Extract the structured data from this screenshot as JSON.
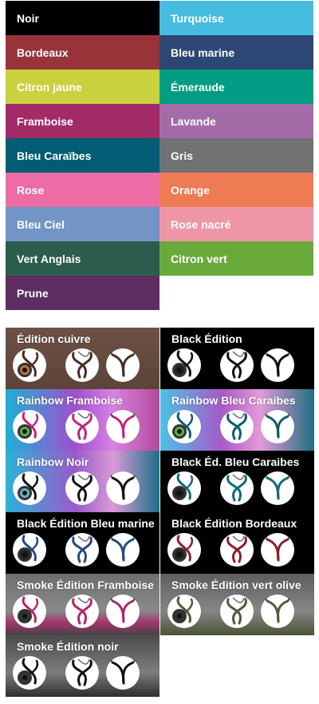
{
  "colors": [
    {
      "label": "Noir",
      "bg": "#000000"
    },
    {
      "label": "Turquoise",
      "bg": "#46bde0"
    },
    {
      "label": "Bordeaux",
      "bg": "#98333a"
    },
    {
      "label": "Bleu marine",
      "bg": "#2d4775"
    },
    {
      "label": "Citron jaune",
      "bg": "#c9d13e"
    },
    {
      "label": "Émeraude",
      "bg": "#009d84"
    },
    {
      "label": "Framboise",
      "bg": "#a32c68"
    },
    {
      "label": "Lavande",
      "bg": "#a46ba9"
    },
    {
      "label": "Bleu Caraïbes",
      "bg": "#005d73"
    },
    {
      "label": "Gris",
      "bg": "#707173"
    },
    {
      "label": "Rose",
      "bg": "#ee6ca5"
    },
    {
      "label": "Orange",
      "bg": "#ee7b53"
    },
    {
      "label": "Bleu Ciel",
      "bg": "#7295c6"
    },
    {
      "label": "Rose nacré",
      "bg": "#ee96a6"
    },
    {
      "label": "Vert Anglais",
      "bg": "#2b5c4d"
    },
    {
      "label": "Citron vert",
      "bg": "#6aaa3b"
    },
    {
      "label": "Prune",
      "bg": "#5e2d61"
    }
  ],
  "editions": [
    {
      "label": "Édition cuivre",
      "bg": "linear-gradient(#6e5146,#5d4338)",
      "tube": "#4a2a20",
      "chest": "#b8743f"
    },
    {
      "label": "Black Édition",
      "bg": "#000000",
      "tube": "#111111",
      "chest": "#222222"
    },
    {
      "label": "Rainbow Framboise",
      "bg": "linear-gradient(90deg,#1fb0d6 0%,#a04fcf 45%,#d882e2 70%,#b14a9a 100%)",
      "tube": "#c0267a",
      "chest": "#5ab04a"
    },
    {
      "label": "Rainbow Bleu Caraibes",
      "bg": "linear-gradient(90deg,#4ac3e5 0%,#a859c8 40%,#e39ad8 65%,#1f6f7f 100%)",
      "tube": "#0c5c6e",
      "chest": "#5ab04a"
    },
    {
      "label": "Rainbow Noir",
      "bg": "linear-gradient(90deg,#2bb3d8 0%,#9a5ac9 45%,#d99ad8 70%,#1c6f86 100%)",
      "tube": "#111111",
      "chest": "#6ab0c8"
    },
    {
      "label": "Black Éd. Bleu Caraibes",
      "bg": "#000000",
      "tube": "#0f6a7c",
      "chest": "#222222"
    },
    {
      "label": "Black Édition Bleu marine",
      "bg": "#000000",
      "tube": "#264a7d",
      "chest": "#222222"
    },
    {
      "label": "Black Édition Bordeaux",
      "bg": "#000000",
      "tube": "#8c1f2b",
      "chest": "#222222"
    },
    {
      "label": "Smoke Édition Framboise",
      "bg": "linear-gradient(#6e6e6e,#8a8a8a 60%,#a3346d 80%,#444)",
      "tube": "#b0276e",
      "chest": "#333333"
    },
    {
      "label": "Smoke Édition vert olive",
      "bg": "linear-gradient(#5e5e5e,#868686 60%,#4a5536)",
      "tube": "#4f5a3a",
      "chest": "#333333"
    },
    {
      "label": "Smoke Édition noir",
      "bg": "linear-gradient(#4b4b4b,#7d7d7d 60%,#2d2d2d)",
      "tube": "#111111",
      "chest": "#333333"
    }
  ]
}
